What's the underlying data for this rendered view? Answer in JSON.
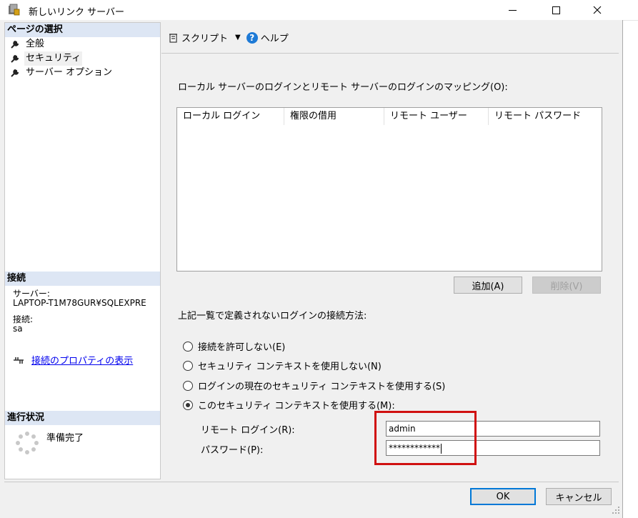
{
  "window": {
    "title": "新しいリンク サーバー",
    "controls": {
      "minimize": "—",
      "maximize": "☐",
      "close": "✕"
    }
  },
  "left": {
    "pages_header": "ページの選択",
    "pages": [
      {
        "label": "全般",
        "icon": "wrench-icon"
      },
      {
        "label": "セキュリティ",
        "icon": "wrench-icon",
        "selected": true
      },
      {
        "label": "サーバー オプション",
        "icon": "wrench-icon"
      }
    ],
    "connection_header": "接続",
    "server_label": "サーバー:",
    "server_value": "LAPTOP-T1M78GUR¥SQLEXPRE",
    "connection_label": "接続:",
    "connection_value": "sa",
    "view_props_link": "接続のプロパティの表示",
    "progress_header": "進行状況",
    "progress_status": "準備完了"
  },
  "toolbar": {
    "script_label": "スクリプト",
    "help_label": "ヘルプ"
  },
  "mapping": {
    "label": "ローカル サーバーのログインとリモート サーバーのログインのマッピング(O):",
    "columns": [
      "ローカル ログイン",
      "権限の借用",
      "リモート ユーザー",
      "リモート パスワード"
    ],
    "add_button": "追加(A)",
    "remove_button": "削除(V)"
  },
  "unmapped": {
    "label": "上記一覧で定義されないログインの接続方法:",
    "options": [
      {
        "label": "接続を許可しない(E)",
        "selected": false
      },
      {
        "label": "セキュリティ コンテキストを使用しない(N)",
        "selected": false
      },
      {
        "label": "ログインの現在のセキュリティ コンテキストを使用する(S)",
        "selected": false
      },
      {
        "label": "このセキュリティ コンテキストを使用する(M):",
        "selected": true
      }
    ],
    "remote_login_label": "リモート ログイン(R):",
    "remote_login_value": "admin",
    "password_label": "パスワード(P):",
    "password_value": "************"
  },
  "footer": {
    "ok_button": "OK",
    "cancel_button": "キャンセル"
  },
  "colors": {
    "section_header_bg": "#dde6f4",
    "highlight_border": "#d01010",
    "link": "#0000ee",
    "help_icon": "#1e7ad6"
  }
}
